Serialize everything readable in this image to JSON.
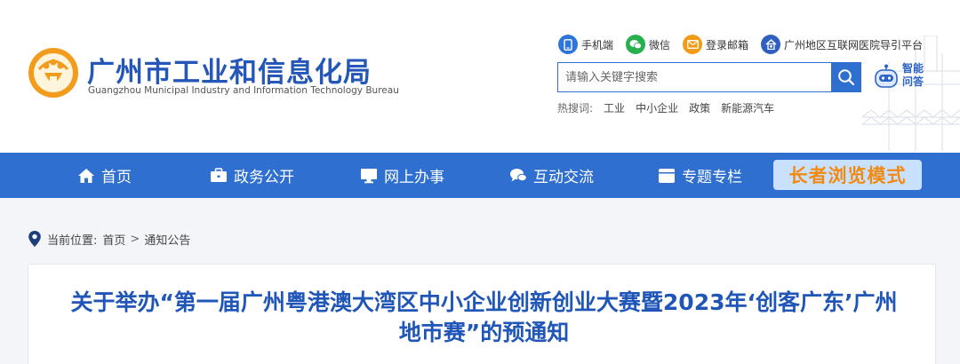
{
  "site": {
    "name_cn": "广州市工业和信息化局",
    "name_en": "Guangzhou Municipal Industry and Information Technology Bureau"
  },
  "toplinks": [
    {
      "label": "手机端",
      "icon": "phone-icon"
    },
    {
      "label": "微信",
      "icon": "wechat-icon"
    },
    {
      "label": "登录邮箱",
      "icon": "mail-icon"
    },
    {
      "label": "广州地区互联网医院导引平台",
      "icon": "hospital-icon"
    }
  ],
  "search": {
    "placeholder": "请输入关键字搜索",
    "value": ""
  },
  "assistant": {
    "label": "智能问答"
  },
  "hotwords": {
    "label": "热搜词:",
    "items": [
      "工业",
      "中小企业",
      "政策",
      "新能源汽车"
    ]
  },
  "nav": {
    "items": [
      {
        "label": "首页",
        "icon": "home-icon"
      },
      {
        "label": "政务公开",
        "icon": "briefcase-icon"
      },
      {
        "label": "网上办事",
        "icon": "monitor-icon"
      },
      {
        "label": "互动交流",
        "icon": "chat-icon"
      },
      {
        "label": "专题专栏",
        "icon": "window-icon"
      }
    ],
    "elder_mode": "长者浏览模式"
  },
  "breadcrumb": {
    "label": "当前位置:",
    "items": [
      "首页",
      "通知公告"
    ],
    "separator": ">"
  },
  "article": {
    "title": "关于举办“第一届广州粤港澳大湾区中小企业创新创业大赛暨2023年‘创客广东’广州地市赛”的预通知"
  },
  "colors": {
    "nav_bg": "#2f6fcf",
    "title_blue": "#1f56b7",
    "elder_text": "#f08a13",
    "logo_orange": "#f29b1d"
  }
}
